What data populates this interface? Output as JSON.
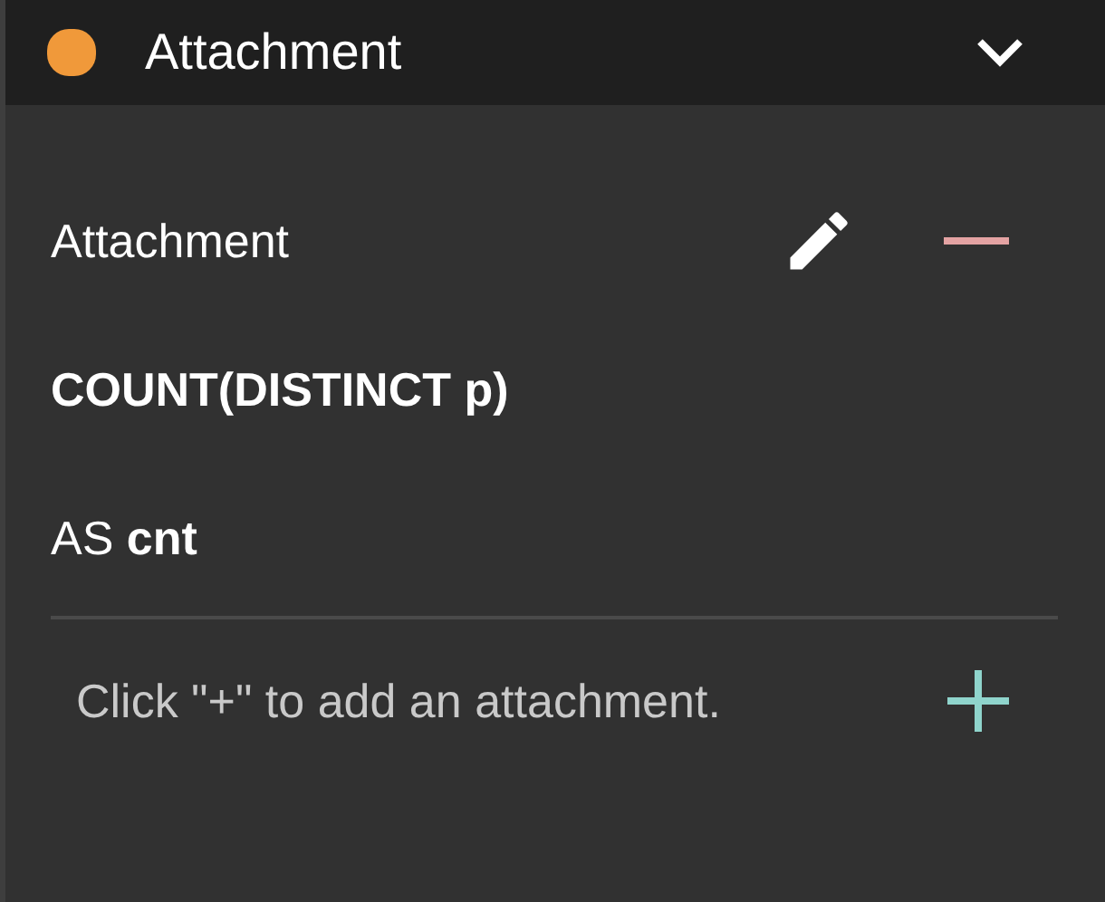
{
  "header": {
    "color": "#f0993a",
    "title": "Attachment"
  },
  "attachment": {
    "name": "Attachment",
    "expression": "COUNT(DISTINCT p)",
    "alias": "AS **cnt**"
  },
  "hint": "Click \"+\" to add an attachment."
}
